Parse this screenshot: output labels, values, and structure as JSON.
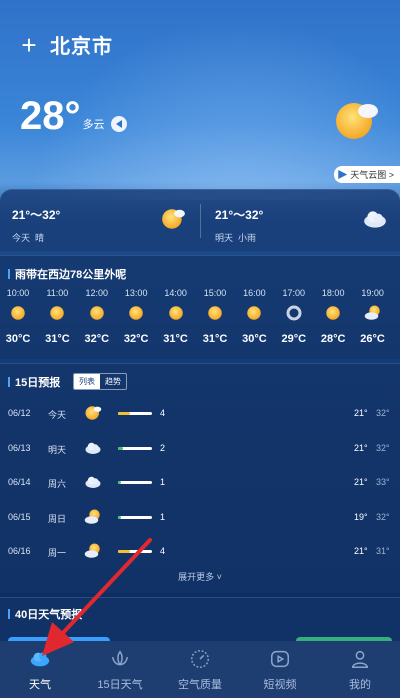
{
  "header": {
    "plus_symbol": "+",
    "city": "北京市"
  },
  "current": {
    "temperature": "28°",
    "condition": "多云",
    "icon": "sun-cloud-icon"
  },
  "map_button": {
    "label": "天气云图 >"
  },
  "today_tomorrow": [
    {
      "range": "21°～32°",
      "day": "今天",
      "condition": "晴",
      "icon": "sun-icon"
    },
    {
      "range": "21°～32°",
      "day": "明天",
      "condition": "小雨",
      "icon": "cloud-icon"
    }
  ],
  "hourly": {
    "title": "雨带在西边78公里外呢",
    "items": [
      {
        "time": "10:00",
        "temp": "30°C",
        "icon": "sun-icon"
      },
      {
        "time": "11:00",
        "temp": "31°C",
        "icon": "sun-icon"
      },
      {
        "time": "12:00",
        "temp": "32°C",
        "icon": "sun-icon"
      },
      {
        "time": "13:00",
        "temp": "32°C",
        "icon": "sun-icon"
      },
      {
        "time": "14:00",
        "temp": "31°C",
        "icon": "sun-icon"
      },
      {
        "time": "15:00",
        "temp": "31°C",
        "icon": "sun-icon"
      },
      {
        "time": "16:00",
        "temp": "30°C",
        "icon": "sun-icon"
      },
      {
        "time": "17:00",
        "temp": "29°C",
        "icon": "haze-icon"
      },
      {
        "time": "18:00",
        "temp": "28°C",
        "icon": "sun-icon"
      },
      {
        "time": "19:00",
        "temp": "26°C",
        "icon": "partly-cloudy-icon"
      }
    ]
  },
  "forecast15": {
    "title": "15日预报",
    "tab_list": "列表",
    "tab_trend": "趋势",
    "days": [
      {
        "date": "06/12",
        "week": "今天",
        "icon": "sun-cloud-icon",
        "aqi": "4",
        "aqi_fill": 0.35,
        "aqi_color": "#f2c230",
        "low": "21°",
        "high": "32°"
      },
      {
        "date": "06/13",
        "week": "明天",
        "icon": "cloud-icon",
        "aqi": "2",
        "aqi_fill": 0.15,
        "aqi_color": "#45c16a",
        "low": "21°",
        "high": "32°"
      },
      {
        "date": "06/14",
        "week": "周六",
        "icon": "cloud-icon",
        "aqi": "1",
        "aqi_fill": 0.1,
        "aqi_color": "#45c16a",
        "low": "21°",
        "high": "33°"
      },
      {
        "date": "06/15",
        "week": "周日",
        "icon": "partly-cloudy-icon",
        "aqi": "1",
        "aqi_fill": 0.1,
        "aqi_color": "#45c16a",
        "low": "19°",
        "high": "32°"
      },
      {
        "date": "06/16",
        "week": "周一",
        "icon": "partly-cloudy-icon",
        "aqi": "4",
        "aqi_fill": 0.35,
        "aqi_color": "#f2c230",
        "low": "21°",
        "high": "31°"
      }
    ],
    "more": "展开更多 ˅"
  },
  "forecast40": {
    "title": "40日天气预报"
  },
  "tabs": [
    {
      "label": "天气",
      "icon": "weather-cloud-icon",
      "active": true
    },
    {
      "label": "15日天气",
      "icon": "lotus-icon",
      "active": false
    },
    {
      "label": "空气质量",
      "icon": "gauge-icon",
      "active": false
    },
    {
      "label": "短视频",
      "icon": "play-icon",
      "active": false
    },
    {
      "label": "我的",
      "icon": "user-icon",
      "active": false
    }
  ],
  "colors": {
    "accent": "#4aa3ff",
    "arrow": "#e0282e",
    "sun": "#f7b533"
  }
}
